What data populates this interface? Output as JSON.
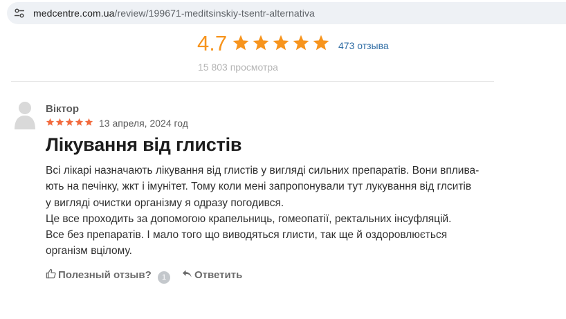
{
  "browser": {
    "url_domain": "medcentre.com.ua",
    "url_path": "/review/199671-meditsinskiy-tsentr-alternativa"
  },
  "summary": {
    "rating": "4.7",
    "stars_filled": 5,
    "star_color": "#f7941d",
    "reviews_count": "473 отзыва",
    "views": "15 803 просмотра"
  },
  "review": {
    "author": "Віктор",
    "stars": 5,
    "star_color": "#f26a3d",
    "date": "13 апреля, 2024 год",
    "title": "Лікування від глистів",
    "body_lines": [
      "Всі лікарі назначають лікування від глистів у вигляді сильних препаратів. Вони вплива-",
      "ють на печінку, жкт і імунітет. Тому коли мені запропонували тут лукування від глситів",
      "у вигляді очистки організму я одразу погодився.",
      "Це все проходить за допомогою крапельниць, гомеопатії, ректальних інсуфляцій.",
      "Все без препаратів. І мало того що виводяться глисти, так ще й оздоровлюється",
      "організм вцілому."
    ],
    "helpful_label": "Полезный отзыв?",
    "helpful_count": "1",
    "reply_label": "Ответить"
  },
  "icons": {
    "address_bar": "tune-icon",
    "avatar": "user-placeholder-icon",
    "helpful": "thumbs-up-icon",
    "reply": "reply-arrow-icon",
    "star": "star-icon"
  }
}
